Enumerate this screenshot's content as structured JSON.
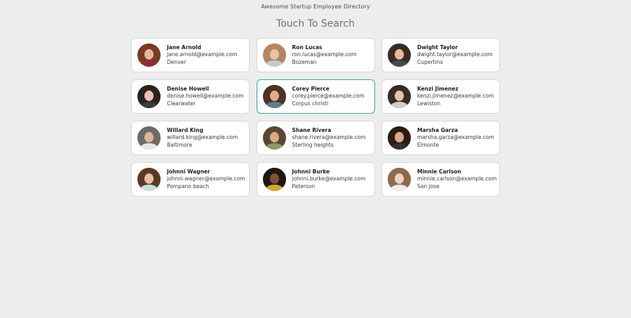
{
  "header": {
    "app_title": "Awesome Startup Employee Directory",
    "search_prompt": "Touch To Search"
  },
  "employees": [
    {
      "name": "Jane Arnold",
      "email": "jane.arnold@example.com",
      "city": "Denver",
      "skin": "#e4b79a",
      "hair": "#7a3b22",
      "shirt": "#8a2f3a"
    },
    {
      "name": "Ron Lucas",
      "email": "ron.lucas@example.com",
      "city": "Bozeman",
      "skin": "#e7c2a8",
      "hair": "#b58563",
      "shirt": "#c9c9c9"
    },
    {
      "name": "Dwight Taylor",
      "email": "dwight.taylor@example.com",
      "city": "Cupertino",
      "skin": "#e2bca2",
      "hair": "#3b2c23",
      "shirt": "#4a4a4a"
    },
    {
      "name": "Denise Howell",
      "email": "denise.howell@example.com",
      "city": "Clearwater",
      "skin": "#e8c3ad",
      "hair": "#2e211c",
      "shirt": "#3b3b3b"
    },
    {
      "name": "Corey Pierce",
      "email": "corey.pierce@example.com",
      "city": "Corpus christi",
      "skin": "#dcae8e",
      "hair": "#4b3325",
      "shirt": "#5d7f8f"
    },
    {
      "name": "Kenzi Jimenez",
      "email": "kenzi.jimenez@example.com",
      "city": "Lewiston",
      "skin": "#e6c2ad",
      "hair": "#3a2a24",
      "shirt": "#cfcfcf"
    },
    {
      "name": "Willard King",
      "email": "willard.king@example.com",
      "city": "Baltimore",
      "skin": "#d9b59a",
      "hair": "#6c6a66",
      "shirt": "#e7e7e7"
    },
    {
      "name": "Shane Rivera",
      "email": "shane.rivera@example.com",
      "city": "Sterling heights",
      "skin": "#d8a985",
      "hair": "#5a4632",
      "shirt": "#8a9a6c"
    },
    {
      "name": "Marsha Garza",
      "email": "marsha.garza@example.com",
      "city": "Elmonte",
      "skin": "#d8a88e",
      "hair": "#2b1c16",
      "shirt": "#3a2c28"
    },
    {
      "name": "Johnni Wagner",
      "email": "johnni.wagner@example.com",
      "city": "Pompano beach",
      "skin": "#e6c0a4",
      "hair": "#5a3a27",
      "shirt": "#c9dede"
    },
    {
      "name": "Johnni Burke",
      "email": "johnni.burke@example.com",
      "city": "Paterson",
      "skin": "#7a5238",
      "hair": "#1f1712",
      "shirt": "#d7a52d"
    },
    {
      "name": "Minnie Carlson",
      "email": "minnie.carlson@example.com",
      "city": "San jose",
      "skin": "#ecd2c0",
      "hair": "#8c6a4e",
      "shirt": "#f1ece8"
    }
  ],
  "active_index": 4
}
